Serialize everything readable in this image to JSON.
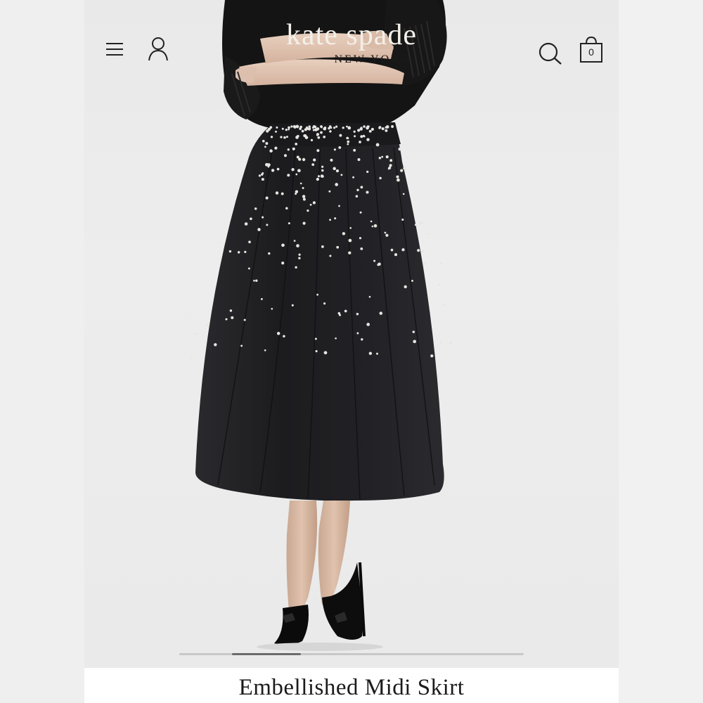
{
  "brand": {
    "name": "kate spade",
    "sublabel": "NEW YORK"
  },
  "header": {
    "menu_icon": "hamburger-menu-icon",
    "account_icon": "user-account-icon",
    "search_icon": "search-icon",
    "bag_icon": "shopping-bag-icon",
    "bag_count": "0"
  },
  "gallery": {
    "active_index_fraction": 0.24,
    "thumb_fraction": 0.2
  },
  "product": {
    "title": "Embellished Midi Skirt"
  },
  "colors": {
    "skirt": "#1e1e21",
    "sweater": "#111111",
    "background": "#ececec"
  }
}
